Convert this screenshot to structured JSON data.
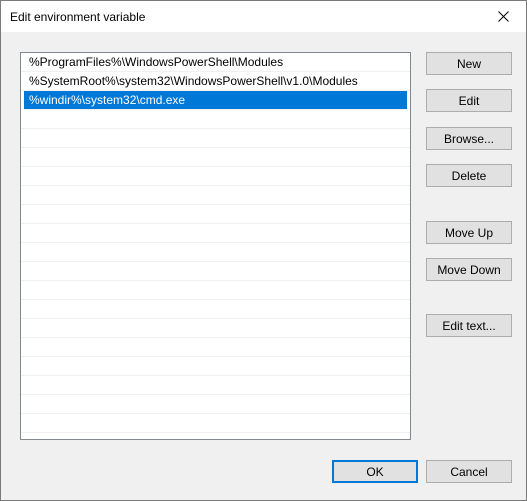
{
  "window": {
    "title": "Edit environment variable"
  },
  "list": {
    "items": [
      "%ProgramFiles%\\WindowsPowerShell\\Modules",
      "%SystemRoot%\\system32\\WindowsPowerShell\\v1.0\\Modules",
      "%windir%\\system32\\cmd.exe"
    ],
    "selected_index": 2
  },
  "buttons": {
    "new": "New",
    "edit": "Edit",
    "browse": "Browse...",
    "delete": "Delete",
    "move_up": "Move Up",
    "move_down": "Move Down",
    "edit_text": "Edit text...",
    "ok": "OK",
    "cancel": "Cancel"
  },
  "colors": {
    "selection": "#0078d7",
    "dialog_background": "#f0f0f0",
    "button_face": "#e1e1e1"
  },
  "icons": {
    "close": "close-icon"
  }
}
